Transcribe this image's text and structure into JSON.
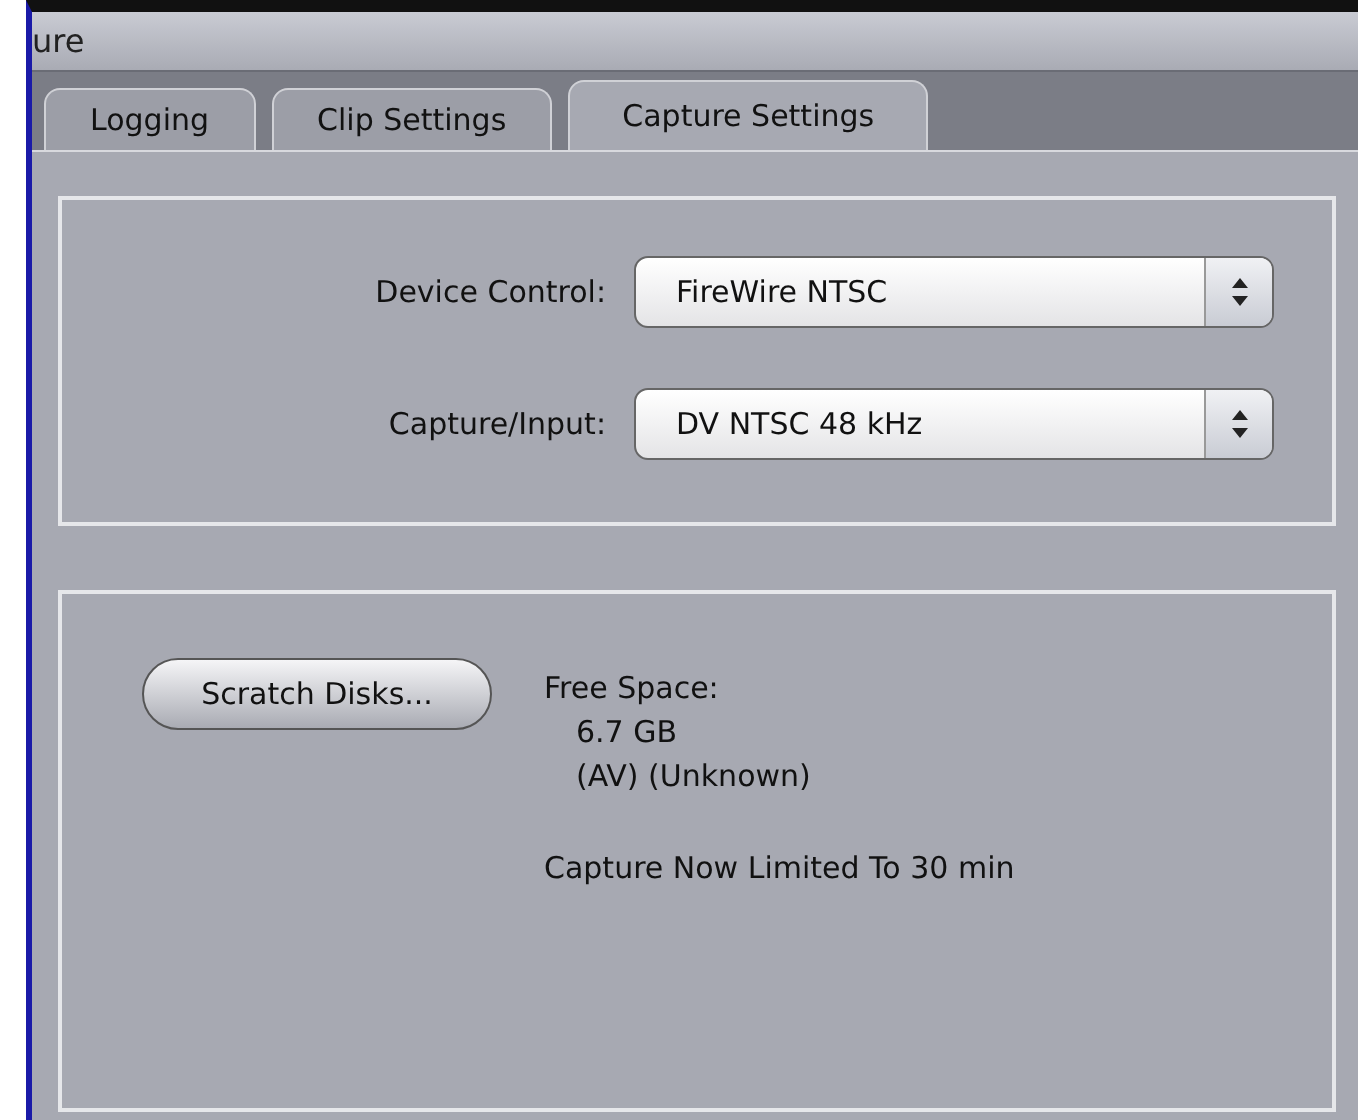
{
  "window": {
    "title": "ure"
  },
  "tabs": [
    {
      "label": "Logging",
      "selected": false
    },
    {
      "label": "Clip Settings",
      "selected": false
    },
    {
      "label": "Capture Settings",
      "selected": true
    }
  ],
  "settings": [
    {
      "label": "Device Control:",
      "value": "FireWire NTSC"
    },
    {
      "label": "Capture/Input:",
      "value": "DV NTSC 48 kHz"
    }
  ],
  "scratch_button": "Scratch Disks...",
  "free_space": {
    "label": "Free Space:",
    "lines": [
      "6.7 GB",
      "(AV) (Unknown)"
    ]
  },
  "capture_limit": "Capture Now Limited To 30 min"
}
